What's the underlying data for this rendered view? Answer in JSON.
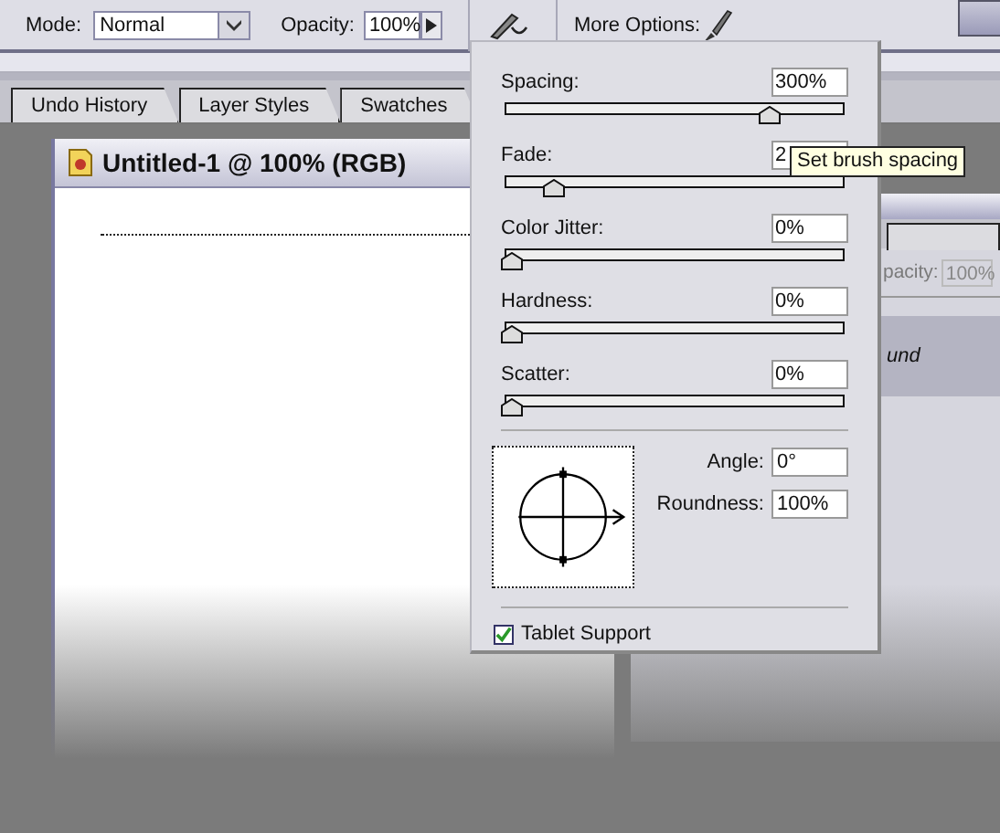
{
  "toolbar": {
    "mode_label": "Mode:",
    "mode_value": "Normal",
    "opacity_label": "Opacity:",
    "opacity_value": "100%",
    "more_options_label": "More Options:"
  },
  "palette_tabs": [
    {
      "label": "Undo History"
    },
    {
      "label": "Layer Styles"
    },
    {
      "label": "Swatches"
    }
  ],
  "document": {
    "title": "Untitled-1 @ 100% (RGB)"
  },
  "layers_panel": {
    "opacity_label": "pacity:",
    "opacity_value": "100%",
    "layer_name": "und"
  },
  "brush_options": {
    "sliders": [
      {
        "label": "Spacing:",
        "value": "300%",
        "level": 0.8
      },
      {
        "label": "Fade:",
        "value": "2",
        "level": 0.13
      },
      {
        "label": "Color Jitter:",
        "value": "0%",
        "level": 0
      },
      {
        "label": "Hardness:",
        "value": "0%",
        "level": 0
      },
      {
        "label": "Scatter:",
        "value": "0%",
        "level": 0
      }
    ],
    "angle_label": "Angle:",
    "angle_value": "0°",
    "roundness_label": "Roundness:",
    "roundness_value": "100%",
    "tablet_support": {
      "label": "Tablet Support",
      "checked": true
    }
  },
  "tooltip": "Set brush spacing"
}
